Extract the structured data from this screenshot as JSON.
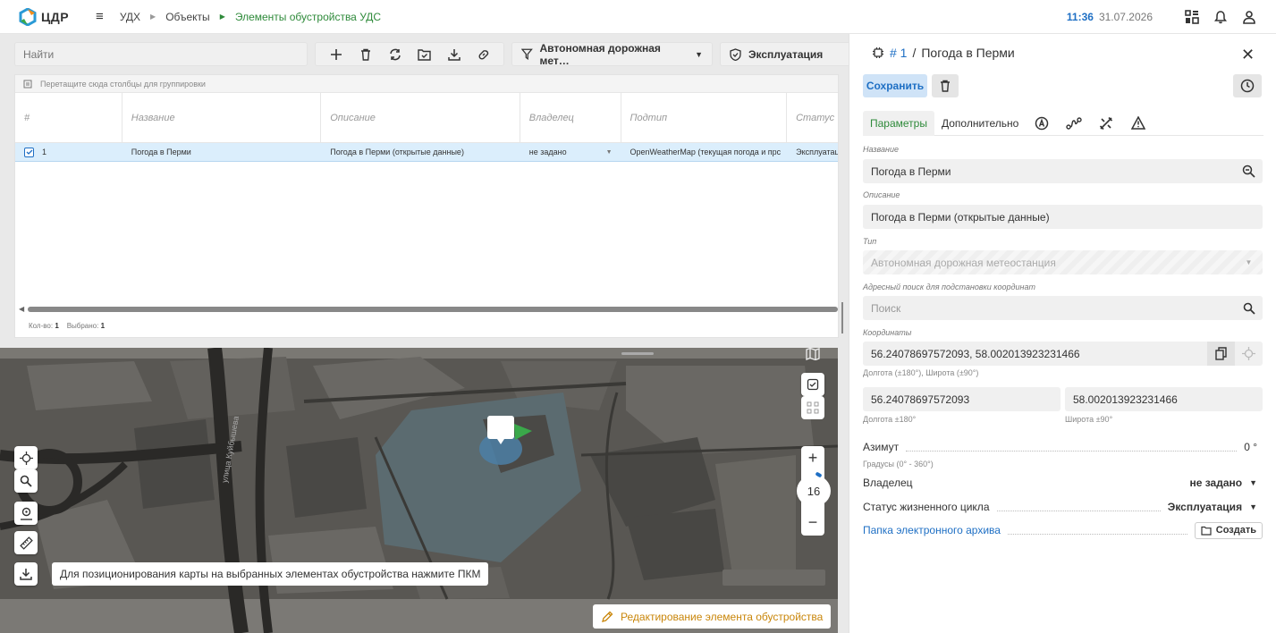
{
  "header": {
    "logo_text": "ЦДР",
    "breadcrumbs": [
      "УДХ",
      "Объекты",
      "Элементы обустройства УДС"
    ],
    "time": "11:36",
    "date": "31.07.2026"
  },
  "toolbar": {
    "search_placeholder": "Найти",
    "type_filter": "Автономная дорожная мет…",
    "status_filter": "Эксплуатация"
  },
  "grid": {
    "group_hint": "Перетащите сюда столбцы для группировки",
    "columns": [
      "#",
      "Название",
      "Описание",
      "Владелец",
      "Подтип",
      "Статус"
    ],
    "rows": [
      {
        "num": "1",
        "name": "Погода в Перми",
        "description": "Погода в Перми (открытые данные)",
        "owner": "не задано",
        "subtype": "OpenWeatherMap (текущая погода и прс",
        "status": "Эксплуатация"
      }
    ],
    "footer_count_label": "Кол-во:",
    "footer_count": "1",
    "footer_selected_label": "Выбрано:",
    "footer_selected": "1"
  },
  "map": {
    "street_label": "улица Куйбышева",
    "zoom": "16",
    "hint": "Для позиционирования карты на выбранных элементах обустройства нажмите ПКМ",
    "edit_button": "Редактирование элемента обустройства"
  },
  "panel": {
    "title_num": "# 1",
    "title_sep": "/",
    "title_name": "Погода в Перми",
    "save_label": "Сохранить",
    "tabs": [
      "Параметры",
      "Дополнительно"
    ],
    "fields": {
      "name_label": "Название",
      "name_value": "Погода в Перми",
      "desc_label": "Описание",
      "desc_value": "Погода в Перми (открытые данные)",
      "type_label": "Тип",
      "type_value": "Автономная дорожная метеостанция",
      "addr_label": "Адресный поиск для подстановки координат",
      "addr_placeholder": "Поиск",
      "coords_label": "Координаты",
      "coords_value": "56.24078697572093, 58.002013923231466",
      "coords_hint": "Долгота (±180°), Широта (±90°)",
      "lon_value": "56.24078697572093",
      "lon_hint": "Долгота ±180°",
      "lat_value": "58.002013923231466",
      "lat_hint": "Широта ±90°"
    },
    "props": {
      "azimuth_key": "Азимут",
      "azimuth_val": "0 °",
      "azimuth_hint": "Градусы (0° - 360°)",
      "owner_key": "Владелец",
      "owner_val": "не задано",
      "lifecycle_key": "Статус жизненного цикла",
      "lifecycle_val": "Эксплуатация",
      "archive_key": "Папка электронного архива",
      "archive_btn": "Создать"
    }
  },
  "colors": {
    "accent": "#1e6fc4",
    "active_green": "#2e8a3a",
    "edit_orange": "#c9860a"
  }
}
